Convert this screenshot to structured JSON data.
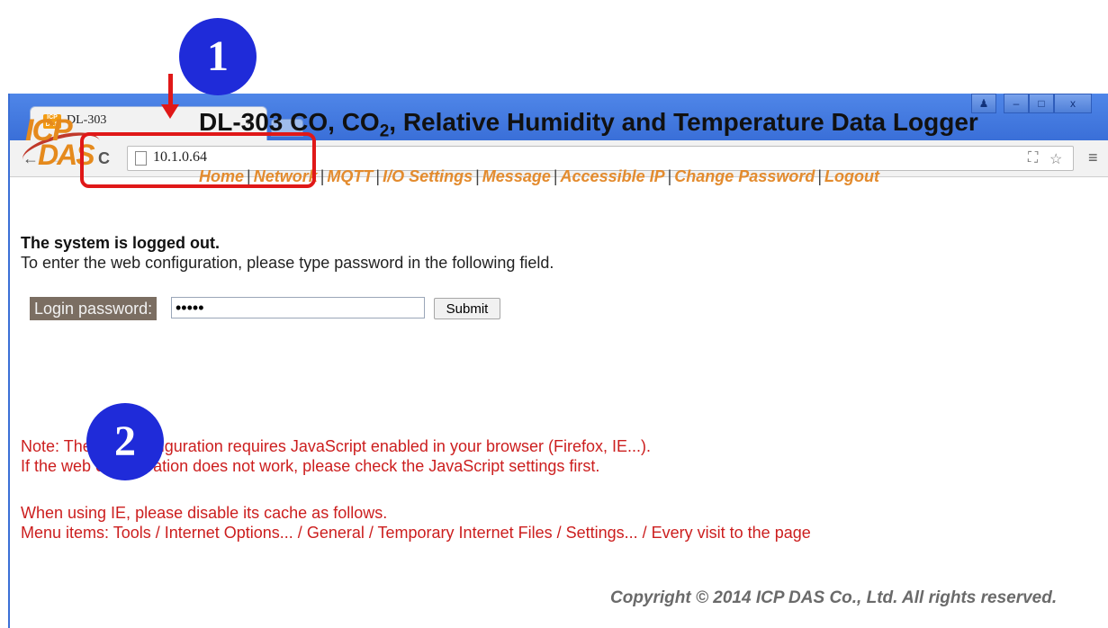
{
  "browser": {
    "tab_title": "DL-303",
    "tab_close": "×",
    "favicon_text": "ICP DAS",
    "url": "10.1.0.64",
    "window_controls": [
      "♟",
      "–",
      "□",
      "x"
    ]
  },
  "header": {
    "logo_top": "ICP",
    "logo_bottom": "DAS",
    "title_main": "DL-303 CO, CO",
    "title_sub": "2",
    "title_rest": ", Relative Humidity and Temperature Data Logger"
  },
  "menu": {
    "items": [
      "Home",
      "Network",
      "MQTT",
      "I/O Settings",
      "Message",
      "Accessible IP",
      "Change Password",
      "Logout"
    ],
    "separator": "|"
  },
  "status": {
    "heading": "The system is logged out.",
    "description": "To enter the web configuration, please type password in the following field."
  },
  "login": {
    "label": "Login password:",
    "value": "•••••",
    "submit_label": "Submit"
  },
  "notes": {
    "line1": "Note: The web configuration requires JavaScript enabled in your browser (Firefox, IE...).",
    "line2": "If the web configuration does not work, please check the JavaScript settings first.",
    "line3": "When using IE, please disable its cache as follows.",
    "line4": "Menu items: Tools / Internet Options... / General / Temporary Internet Files / Settings... / Every visit to the page"
  },
  "footer": {
    "copyright": "Copyright © 2014 ICP DAS Co., Ltd. All rights reserved."
  },
  "annotations": {
    "badge1": "1",
    "badge2": "2"
  },
  "colors": {
    "accent_red": "#e01818",
    "badge_blue": "#1f2bd9",
    "menu_orange": "#e38b2e",
    "note_red": "#cc1e1e"
  }
}
